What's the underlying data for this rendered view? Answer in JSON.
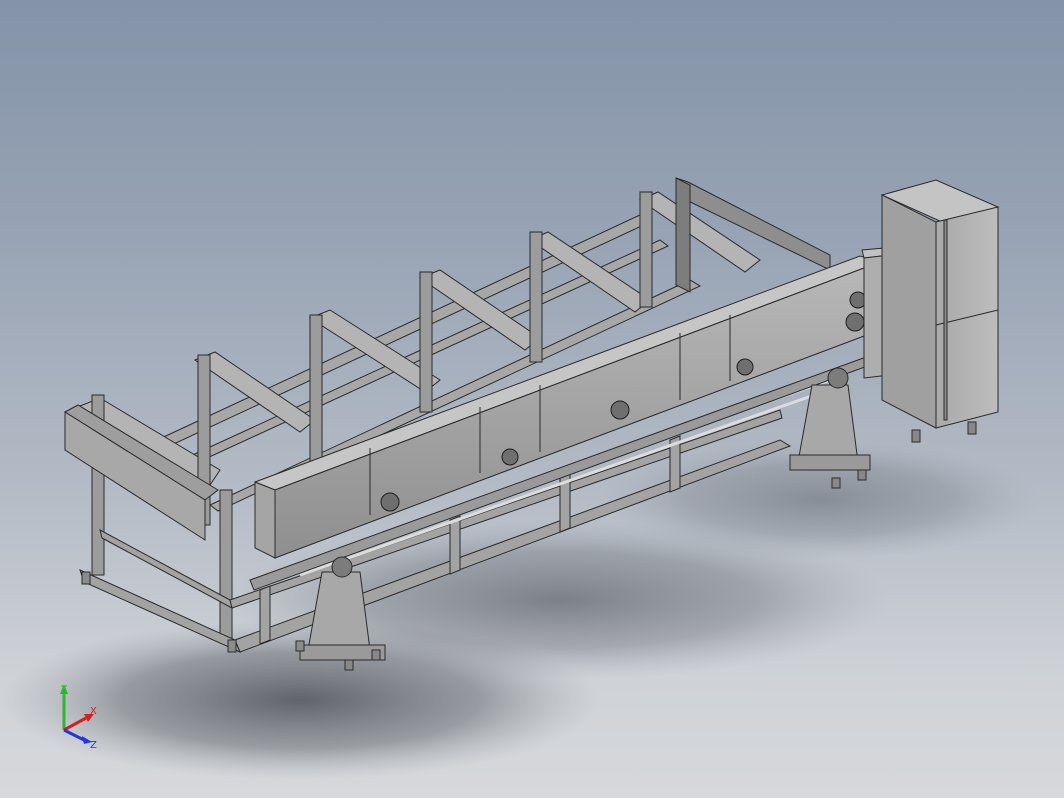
{
  "viewport": {
    "background_top": "#8493a8",
    "background_bottom": "#d6d8db"
  },
  "triad": {
    "x_label": "X",
    "y_label": "Y",
    "z_label": "Z",
    "x_color": "#d62020",
    "y_color": "#2fb52f",
    "z_color": "#2238d6"
  }
}
